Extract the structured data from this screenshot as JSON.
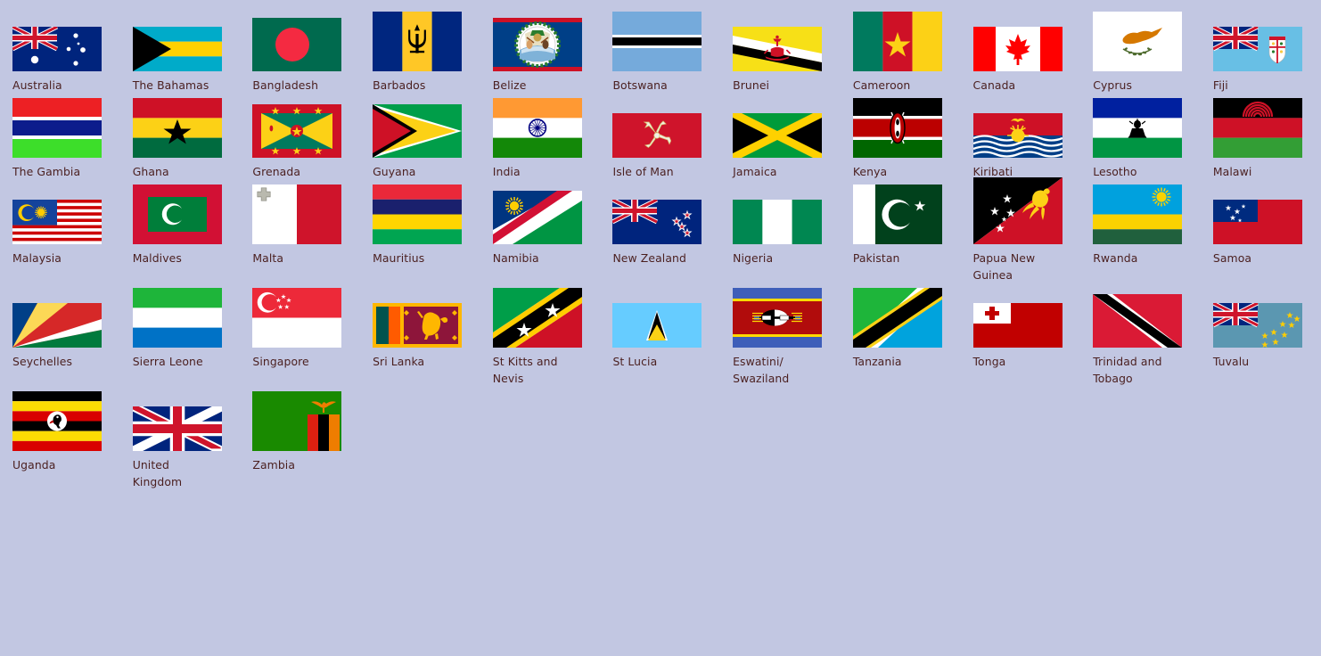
{
  "page": {
    "title": "Commonwealth member flags grid",
    "background_color": "#c2c7e2",
    "label_color": "#4a1f1f",
    "columns": 11
  },
  "flags": [
    {
      "name": "Australia",
      "label": "Australia",
      "w": 100,
      "h": 50,
      "row": 1,
      "col": 1
    },
    {
      "name": "The Bahamas",
      "label": "The Bahamas",
      "w": 100,
      "h": 50,
      "row": 1,
      "col": 2
    },
    {
      "name": "Bangladesh",
      "label": "Bangladesh",
      "w": 100,
      "h": 60,
      "row": 1,
      "col": 3
    },
    {
      "name": "Barbados",
      "label": "Barbados",
      "w": 100,
      "h": 67,
      "row": 1,
      "col": 4
    },
    {
      "name": "Belize",
      "label": "Belize",
      "w": 100,
      "h": 60,
      "row": 1,
      "col": 5
    },
    {
      "name": "Botswana",
      "label": "Botswana",
      "w": 100,
      "h": 67,
      "row": 1,
      "col": 6
    },
    {
      "name": "Brunei",
      "label": "Brunei",
      "w": 100,
      "h": 50,
      "row": 1,
      "col": 7
    },
    {
      "name": "Cameroon",
      "label": "Cameroon",
      "w": 100,
      "h": 67,
      "row": 1,
      "col": 8
    },
    {
      "name": "Canada",
      "label": "Canada",
      "w": 100,
      "h": 50,
      "row": 1,
      "col": 9
    },
    {
      "name": "Cyprus",
      "label": "Cyprus",
      "w": 100,
      "h": 67,
      "row": 1,
      "col": 10
    },
    {
      "name": "Fiji",
      "label": "Fiji",
      "w": 100,
      "h": 50,
      "row": 1,
      "col": 11
    },
    {
      "name": "The Gambia",
      "label": "The Gambia",
      "w": 100,
      "h": 67,
      "row": 2,
      "col": 1
    },
    {
      "name": "Ghana",
      "label": "Ghana",
      "w": 100,
      "h": 67,
      "row": 2,
      "col": 2
    },
    {
      "name": "Grenada",
      "label": "Grenada",
      "w": 100,
      "h": 60,
      "row": 2,
      "col": 3
    },
    {
      "name": "Guyana",
      "label": "Guyana",
      "w": 100,
      "h": 60,
      "row": 2,
      "col": 4
    },
    {
      "name": "India",
      "label": "India",
      "w": 100,
      "h": 67,
      "row": 2,
      "col": 5
    },
    {
      "name": "Isle of Man",
      "label": "Isle of Man",
      "w": 100,
      "h": 50,
      "row": 2,
      "col": 6
    },
    {
      "name": "Jamaica",
      "label": "Jamaica",
      "w": 100,
      "h": 50,
      "row": 2,
      "col": 7
    },
    {
      "name": "Kenya",
      "label": "Kenya",
      "w": 100,
      "h": 67,
      "row": 2,
      "col": 8
    },
    {
      "name": "Kiribati",
      "label": "Kiribati",
      "w": 100,
      "h": 50,
      "row": 2,
      "col": 9
    },
    {
      "name": "Lesotho",
      "label": "Lesotho",
      "w": 100,
      "h": 67,
      "row": 2,
      "col": 10
    },
    {
      "name": "Malawi",
      "label": "Malawi",
      "w": 100,
      "h": 67,
      "row": 2,
      "col": 11
    },
    {
      "name": "Malaysia",
      "label": "Malaysia",
      "w": 100,
      "h": 50,
      "row": 3,
      "col": 1
    },
    {
      "name": "Maldives",
      "label": "Maldives",
      "w": 100,
      "h": 67,
      "row": 3,
      "col": 2
    },
    {
      "name": "Malta",
      "label": "Malta",
      "w": 100,
      "h": 67,
      "row": 3,
      "col": 3
    },
    {
      "name": "Mauritius",
      "label": "Mauritius",
      "w": 100,
      "h": 67,
      "row": 3,
      "col": 4
    },
    {
      "name": "Namibia",
      "label": "Namibia",
      "w": 100,
      "h": 60,
      "row": 3,
      "col": 5
    },
    {
      "name": "New Zealand",
      "label": "New Zealand",
      "w": 100,
      "h": 50,
      "row": 3,
      "col": 6
    },
    {
      "name": "Nigeria",
      "label": "Nigeria",
      "w": 100,
      "h": 50,
      "row": 3,
      "col": 7
    },
    {
      "name": "Pakistan",
      "label": "Pakistan",
      "w": 100,
      "h": 67,
      "row": 3,
      "col": 8
    },
    {
      "name": "Papua New Guinea",
      "label": "Papua New\nGuinea",
      "w": 100,
      "h": 75,
      "row": 3,
      "col": 9
    },
    {
      "name": "Rwanda",
      "label": "Rwanda",
      "w": 100,
      "h": 67,
      "row": 3,
      "col": 10
    },
    {
      "name": "Samoa",
      "label": "Samoa",
      "w": 100,
      "h": 50,
      "row": 3,
      "col": 11
    },
    {
      "name": "Seychelles",
      "label": "Seychelles",
      "w": 100,
      "h": 50,
      "row": 4,
      "col": 1
    },
    {
      "name": "Sierra Leone",
      "label": "Sierra Leone",
      "w": 100,
      "h": 67,
      "row": 4,
      "col": 2
    },
    {
      "name": "Singapore",
      "label": "Singapore",
      "w": 100,
      "h": 67,
      "row": 4,
      "col": 3
    },
    {
      "name": "Sri Lanka",
      "label": "Sri Lanka",
      "w": 100,
      "h": 50,
      "row": 4,
      "col": 4
    },
    {
      "name": "St Kitts and Nevis",
      "label": "St Kitts and\nNevis",
      "w": 100,
      "h": 67,
      "row": 4,
      "col": 5
    },
    {
      "name": "St Lucia",
      "label": "St Lucia",
      "w": 100,
      "h": 50,
      "row": 4,
      "col": 6
    },
    {
      "name": "Eswatini/Swaziland",
      "label": "Eswatini/\nSwaziland",
      "w": 100,
      "h": 67,
      "row": 4,
      "col": 7
    },
    {
      "name": "Tanzania",
      "label": "Tanzania",
      "w": 100,
      "h": 67,
      "row": 4,
      "col": 8
    },
    {
      "name": "Tonga",
      "label": "Tonga",
      "w": 100,
      "h": 50,
      "row": 4,
      "col": 9
    },
    {
      "name": "Trinidad and Tobago",
      "label": "Trinidad and\nTobago",
      "w": 100,
      "h": 60,
      "row": 4,
      "col": 10
    },
    {
      "name": "Tuvalu",
      "label": "Tuvalu",
      "w": 100,
      "h": 50,
      "row": 4,
      "col": 11
    },
    {
      "name": "Uganda",
      "label": "Uganda",
      "w": 100,
      "h": 67,
      "row": 5,
      "col": 1
    },
    {
      "name": "United Kingdom",
      "label": "United\nKingdom",
      "w": 100,
      "h": 50,
      "row": 5,
      "col": 2
    },
    {
      "name": "Zambia",
      "label": "Zambia",
      "w": 100,
      "h": 67,
      "row": 5,
      "col": 3
    }
  ]
}
